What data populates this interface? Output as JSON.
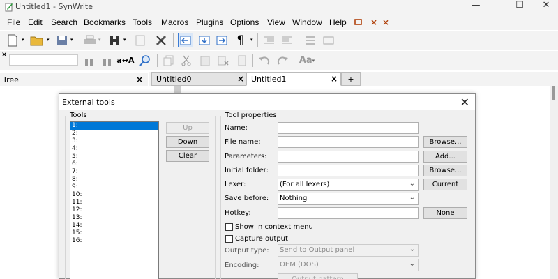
{
  "window": {
    "title": "Untitled1 - SynWrite",
    "minimize": "—",
    "maximize": "☐",
    "close": "✕"
  },
  "menu": [
    "File",
    "Edit",
    "Search",
    "Bookmarks",
    "Tools",
    "Macros",
    "Plugins",
    "Options",
    "View",
    "Window",
    "Help"
  ],
  "search": {
    "value": "",
    "placeholder": ""
  },
  "tree_panel": {
    "title": "Tree",
    "close": "×"
  },
  "tabs": [
    {
      "label": "Untitled0",
      "close": "×"
    },
    {
      "label": "Untitled1",
      "close": "×"
    },
    {
      "label": "+"
    }
  ],
  "dialog": {
    "title": "External tools",
    "close": "✕",
    "tools_group_label": "Tools",
    "tool_items": [
      "1:",
      "2:",
      "3:",
      "4:",
      "5:",
      "6:",
      "7:",
      "8:",
      "9:",
      "10:",
      "11:",
      "12:",
      "13:",
      "14:",
      "15:",
      "16:"
    ],
    "up_label": "Up",
    "down_label": "Down",
    "clear_label": "Clear",
    "props_group_label": "Tool properties",
    "name_label": "Name:",
    "name_value": "",
    "filename_label": "File name:",
    "filename_value": "",
    "browse_label": "Browse...",
    "params_label": "Parameters:",
    "params_value": "",
    "add_label": "Add...",
    "folder_label": "Initial folder:",
    "folder_value": "",
    "browse2_label": "Browse...",
    "lexer_label": "Lexer:",
    "lexer_value": "(For all lexers)",
    "current_label": "Current",
    "savebefore_label": "Save before:",
    "savebefore_value": "Nothing",
    "hotkey_label": "Hotkey:",
    "hotkey_value": "",
    "none_label": "None",
    "show_context_label": "Show in context menu",
    "capture_label": "Capture output",
    "output_type_label": "Output type:",
    "output_type_value": "Send to Output panel",
    "encoding_label": "Encoding:",
    "encoding_value": "OEM (DOS)",
    "output_pattern_label": "Output pattern"
  }
}
